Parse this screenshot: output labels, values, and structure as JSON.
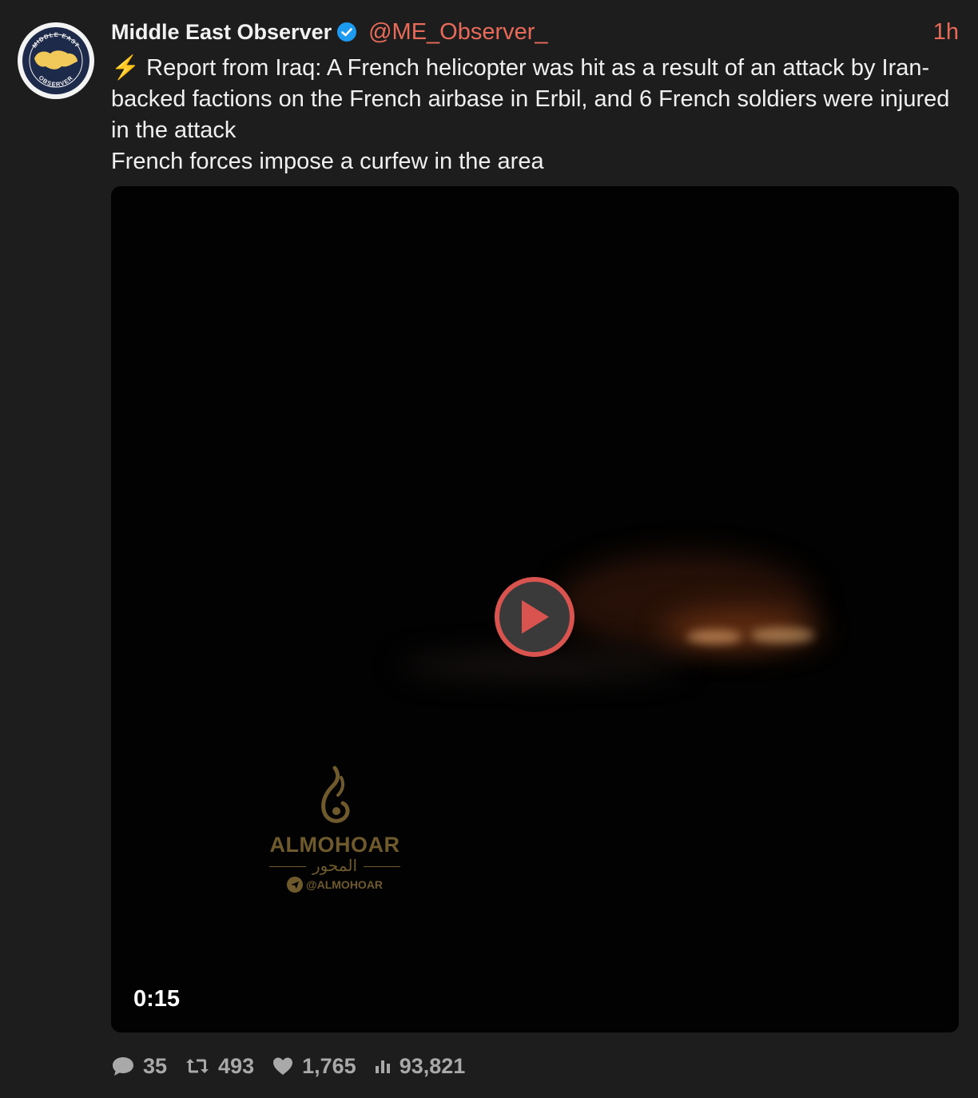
{
  "tweet": {
    "display_name": "Middle East Observer",
    "handle": "@ME_Observer_",
    "time": "1h",
    "verified_icon": "verified-badge-icon",
    "bolt": "⚡",
    "text_line1": "Report from Iraq: A French helicopter was hit as a result of an attack by Iran-backed factions on the French airbase in Erbil, and 6 French soldiers were injured in the attack",
    "text_line2": "French forces impose a curfew in the area"
  },
  "avatar": {
    "ring_text_top": "MIDDLE EAST",
    "ring_text_bottom": "OBSERVER"
  },
  "media": {
    "duration": "0:15",
    "watermark": {
      "name": "ALMOHOAR",
      "arabic": "المحور",
      "tag": "@ALMOHOAR"
    }
  },
  "actions": {
    "replies": "35",
    "retweets": "493",
    "likes": "1,765",
    "views": "93,821"
  },
  "colors": {
    "background": "#1d1d1d",
    "accent": "#e86b5a",
    "play_ring": "#d9534f",
    "verified": "#1d9bf0",
    "watermark": "#6e5a2c"
  }
}
